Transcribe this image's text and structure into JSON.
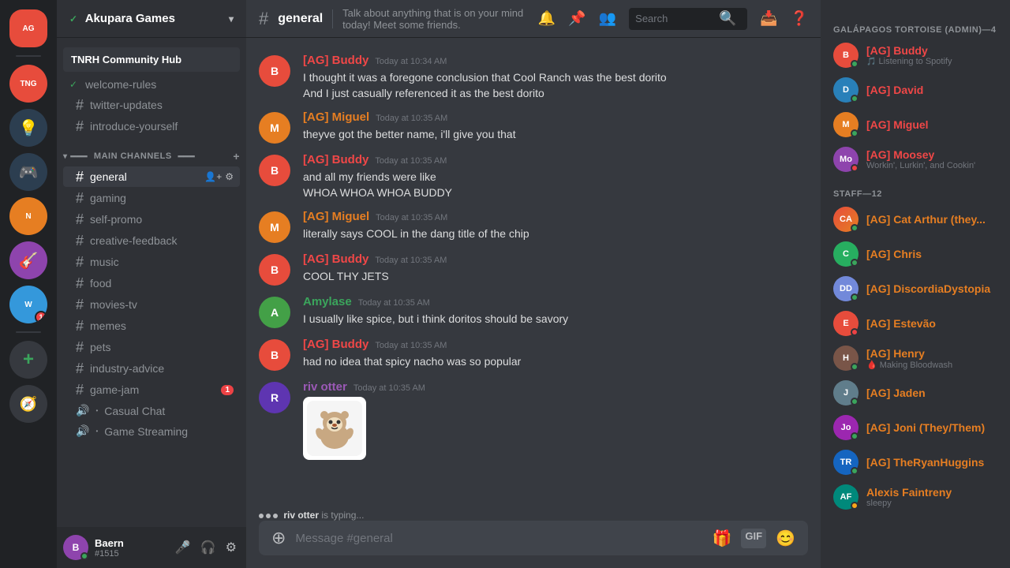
{
  "server": {
    "name": "Akupara Games",
    "has_checkmark": true,
    "chevron": "▾"
  },
  "community_hub": "TNRH Community Hub",
  "channels": {
    "top_items": [
      {
        "id": "welcome-rules",
        "name": "welcome-rules",
        "type": "text",
        "checked": true
      },
      {
        "id": "twitter-updates",
        "name": "twitter-updates",
        "type": "text",
        "active": false
      },
      {
        "id": "introduce-yourself",
        "name": "introduce-yourself",
        "type": "text"
      }
    ],
    "main_channels_label": "MAIN CHANNELS",
    "main_items": [
      {
        "id": "general",
        "name": "general",
        "type": "text",
        "active": true
      },
      {
        "id": "gaming",
        "name": "gaming",
        "type": "text"
      },
      {
        "id": "self-promo",
        "name": "self-promo",
        "type": "text"
      },
      {
        "id": "creative-feedback",
        "name": "creative-feedback",
        "type": "text"
      },
      {
        "id": "music",
        "name": "music",
        "type": "text"
      },
      {
        "id": "food",
        "name": "food",
        "type": "text"
      },
      {
        "id": "movies-tv",
        "name": "movies-tv",
        "type": "text"
      },
      {
        "id": "memes",
        "name": "memes",
        "type": "text"
      },
      {
        "id": "pets",
        "name": "pets",
        "type": "text"
      },
      {
        "id": "industry-advice",
        "name": "industry-advice",
        "type": "text"
      },
      {
        "id": "game-jam",
        "name": "game-jam",
        "type": "text",
        "has_notification": true
      },
      {
        "id": "casual-chat",
        "name": "Casual Chat",
        "type": "voice"
      },
      {
        "id": "game-streaming",
        "name": "Game Streaming",
        "type": "voice"
      }
    ]
  },
  "channel_header": {
    "name": "general",
    "topic": "Talk about anything that is on your mind today! Meet some friends."
  },
  "search": {
    "placeholder": "Search",
    "value": ""
  },
  "messages": [
    {
      "id": "msg1",
      "author": "Buddy",
      "author_tag": "[AG] Buddy",
      "author_class": "buddy",
      "time": "Today at 10:34 AM",
      "avatar_class": "av-buddy",
      "avatar_initials": "B",
      "lines": [
        "I thought it was a foregone conclusion that Cool Ranch was the best dorito",
        "And I just casually referenced it as the best dorito"
      ]
    },
    {
      "id": "msg2",
      "author": "Miguel",
      "author_tag": "[AG] Miguel",
      "author_class": "miguel",
      "time": "Today at 10:35 AM",
      "avatar_class": "av-miguel",
      "avatar_initials": "M",
      "lines": [
        "theyve got the better name, i'll give you that"
      ]
    },
    {
      "id": "msg3",
      "author": "Buddy",
      "author_tag": "[AG] Buddy",
      "author_class": "buddy",
      "time": "Today at 10:35 AM",
      "avatar_class": "av-buddy",
      "avatar_initials": "B",
      "lines": [
        "and all my friends were like",
        "WHOA WHOA WHOA BUDDY"
      ]
    },
    {
      "id": "msg4",
      "author": "Miguel",
      "author_tag": "[AG] Miguel",
      "author_class": "miguel",
      "time": "Today at 10:35 AM",
      "avatar_class": "av-miguel",
      "avatar_initials": "M",
      "lines": [
        "literally says COOL in the dang title of the chip"
      ]
    },
    {
      "id": "msg5",
      "author": "Buddy",
      "author_tag": "[AG] Buddy",
      "author_class": "buddy",
      "time": "Today at 10:35 AM",
      "avatar_class": "av-buddy",
      "avatar_initials": "B",
      "lines": [
        "COOL THY JETS"
      ]
    },
    {
      "id": "msg6",
      "author": "Amylase",
      "author_tag": "Amylase",
      "author_class": "amylase",
      "time": "Today at 10:35 AM",
      "avatar_class": "av-amylase",
      "avatar_initials": "A",
      "lines": [
        "I usually like spice, but i think doritos should be savory"
      ]
    },
    {
      "id": "msg7",
      "author": "Buddy",
      "author_tag": "[AG] Buddy",
      "author_class": "buddy",
      "time": "Today at 10:35 AM",
      "avatar_class": "av-buddy",
      "avatar_initials": "B",
      "lines": [
        "had no idea that spicy nacho was so popular"
      ]
    },
    {
      "id": "msg8",
      "author": "riv otter",
      "author_tag": "riv otter",
      "author_class": "rivotter",
      "time": "Today at 10:35 AM",
      "avatar_class": "av-rivotter",
      "avatar_initials": "R",
      "lines": [],
      "has_sticker": true
    }
  ],
  "input": {
    "placeholder": "Message #general"
  },
  "typing": {
    "user": "riv otter",
    "action": "is typing..."
  },
  "members": {
    "categories": [
      {
        "label": "GALÁPAGOS TORTOISE (ADMIN)—4",
        "members": [
          {
            "name": "[AG] Buddy",
            "name_class": "admin",
            "status": "online",
            "sub": "Listening to Spotify 🎵",
            "av_class": "av-buddy",
            "initials": "B"
          },
          {
            "name": "[AG] David",
            "name_class": "admin",
            "status": "online",
            "sub": "",
            "av_class": "av-david",
            "initials": "D"
          },
          {
            "name": "[AG] Miguel",
            "name_class": "admin",
            "status": "online",
            "sub": "",
            "av_class": "av-miguel",
            "initials": "M"
          },
          {
            "name": "[AG] Moosey",
            "name_class": "admin",
            "status": "dnd",
            "sub": "Workin', Lurkin', and Cookin'",
            "av_class": "av-moosey",
            "initials": "Mo"
          }
        ]
      },
      {
        "label": "STAFF—12",
        "members": [
          {
            "name": "[AG] Cat Arthur (they...",
            "name_class": "staff",
            "status": "online",
            "sub": "",
            "av_class": "av-catarth",
            "initials": "CA"
          },
          {
            "name": "[AG] Chris",
            "name_class": "staff",
            "status": "online",
            "sub": "",
            "av_class": "av-chris",
            "initials": "C"
          },
          {
            "name": "[AG] DiscordiaDystopia",
            "name_class": "staff",
            "status": "online",
            "sub": "",
            "av_class": "av-discord",
            "initials": "DD"
          },
          {
            "name": "[AG] Estevão",
            "name_class": "staff",
            "status": "dnd",
            "sub": "",
            "av_class": "av-estevao",
            "initials": "E"
          },
          {
            "name": "[AG] Henry",
            "name_class": "staff",
            "status": "online",
            "sub": "Making Bloodwash",
            "av_class": "av-henry",
            "initials": "H"
          },
          {
            "name": "[AG] Jaden",
            "name_class": "staff",
            "status": "online",
            "sub": "",
            "av_class": "av-jaden",
            "initials": "J"
          },
          {
            "name": "[AG] Joni (They/Them)",
            "name_class": "staff",
            "status": "online",
            "sub": "",
            "av_class": "av-joni",
            "initials": "Jo"
          },
          {
            "name": "[AG] TheRyanHuggins",
            "name_class": "staff",
            "status": "online",
            "sub": "",
            "av_class": "av-ryan",
            "initials": "TR"
          },
          {
            "name": "Alexis Faintreny",
            "name_class": "staff",
            "status": "idle",
            "sub": "sleepy",
            "av_class": "av-alexis",
            "initials": "AF"
          }
        ]
      }
    ]
  },
  "user": {
    "name": "Baern",
    "tag": "#1515",
    "avatar_class": "av-baern",
    "avatar_initials": "B"
  },
  "server_icons": [
    {
      "id": "main",
      "label": "AG",
      "av_class": "av-buddy",
      "active": true
    },
    {
      "id": "tng",
      "label": "TNG",
      "av_class": "av-tng"
    },
    {
      "id": "s3",
      "label": "💡",
      "av_class": "av-david"
    },
    {
      "id": "s4",
      "label": "🎮",
      "av_class": "av-indie"
    },
    {
      "id": "s5",
      "label": "N",
      "av_class": "av-yng"
    },
    {
      "id": "s6",
      "label": "🎸",
      "av_class": "av-estevao"
    },
    {
      "id": "s7",
      "label": "W",
      "av_class": "av-wombo",
      "notification": "1"
    },
    {
      "id": "discover",
      "label": "🧭",
      "is_discover": true
    }
  ]
}
